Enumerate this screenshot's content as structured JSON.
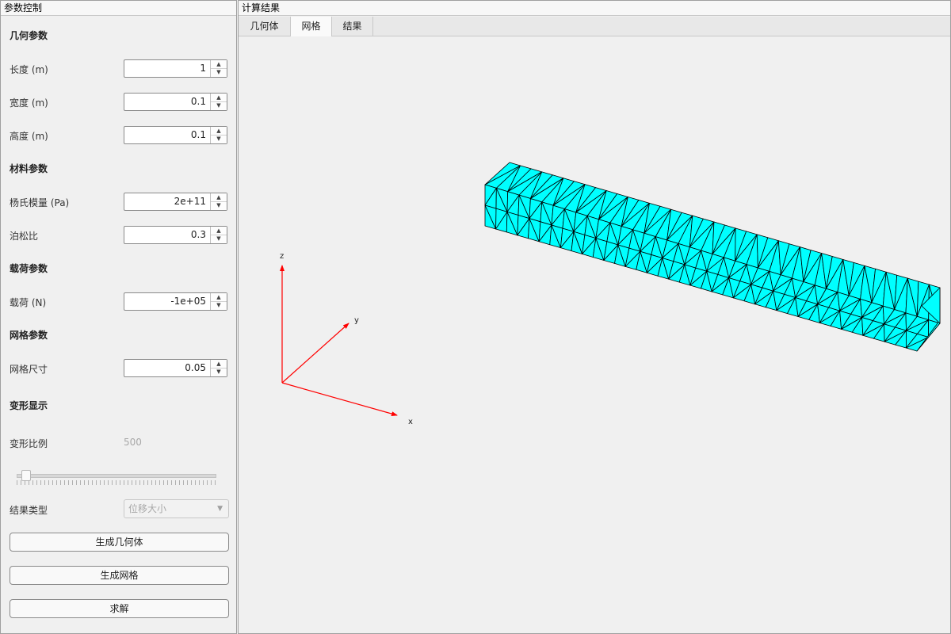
{
  "left_panel": {
    "title": "参数控制",
    "geometry": {
      "heading": "几何参数",
      "length": {
        "label": "长度 (m)",
        "value": "1"
      },
      "width": {
        "label": "宽度 (m)",
        "value": "0.1"
      },
      "height": {
        "label": "高度 (m)",
        "value": "0.1"
      }
    },
    "material": {
      "heading": "材料参数",
      "youngs": {
        "label": "杨氏模量 (Pa)",
        "value": "2e+11"
      },
      "poisson": {
        "label": "泊松比",
        "value": "0.3"
      }
    },
    "load": {
      "heading": "载荷参数",
      "load": {
        "label": "载荷 (N)",
        "value": "-1e+05"
      }
    },
    "mesh": {
      "heading": "网格参数",
      "size": {
        "label": "网格尺寸",
        "value": "0.05"
      }
    },
    "deformation": {
      "heading": "变形显示",
      "scale": {
        "label": "变形比例",
        "value": "500"
      },
      "result_type": {
        "label": "结果类型",
        "selected": "位移大小"
      }
    },
    "buttons": {
      "generate_geometry": "生成几何体",
      "generate_mesh": "生成网格",
      "solve": "求解"
    }
  },
  "right_panel": {
    "title": "计算结果",
    "tabs": [
      "几何体",
      "网格",
      "结果"
    ],
    "active_tab": "网格",
    "axes": {
      "x": "x",
      "y": "y",
      "z": "z"
    },
    "mesh_color": "#00ffff",
    "axis_color": "#ff0000"
  }
}
